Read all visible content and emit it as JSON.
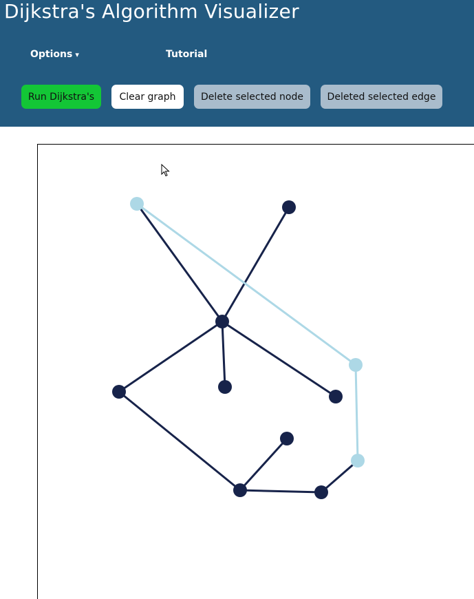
{
  "app": {
    "title": "Dijkstra's Algorithm Visualizer"
  },
  "nav": {
    "options_label": "Options",
    "options_caret": "▾",
    "tutorial_label": "Tutorial"
  },
  "toolbar": {
    "run_label": "Run Dijkstra's",
    "clear_label": "Clear graph",
    "delete_node_label": "Delete selected node",
    "delete_edge_label": "Deleted selected edge"
  },
  "colors": {
    "header_bg": "#235a80",
    "run_button": "#13c636",
    "disabled_button": "#a9bccc",
    "node_default": "#17234a",
    "node_path": "#add8e6",
    "edge_default": "#17234a",
    "edge_path": "#add8e6"
  },
  "graph": {
    "nodes": [
      {
        "id": "n1",
        "state": "path"
      },
      {
        "id": "n2",
        "state": "default"
      },
      {
        "id": "n3",
        "state": "default"
      },
      {
        "id": "n4",
        "state": "path"
      },
      {
        "id": "n5",
        "state": "default"
      },
      {
        "id": "n6",
        "state": "default"
      },
      {
        "id": "n7",
        "state": "default"
      },
      {
        "id": "n8",
        "state": "default"
      },
      {
        "id": "n9",
        "state": "path"
      },
      {
        "id": "n10",
        "state": "default"
      },
      {
        "id": "n11",
        "state": "default"
      }
    ],
    "edges": [
      {
        "from": "n1",
        "to": "n3",
        "state": "default"
      },
      {
        "from": "n2",
        "to": "n3",
        "state": "default"
      },
      {
        "from": "n3",
        "to": "n6",
        "state": "default"
      },
      {
        "from": "n3",
        "to": "n7",
        "state": "default"
      },
      {
        "from": "n3",
        "to": "n5",
        "state": "default"
      },
      {
        "from": "n5",
        "to": "n10",
        "state": "default"
      },
      {
        "from": "n10",
        "to": "n8",
        "state": "default"
      },
      {
        "from": "n10",
        "to": "n11",
        "state": "default"
      },
      {
        "from": "n11",
        "to": "n9",
        "state": "default"
      },
      {
        "from": "n1",
        "to": "n4",
        "state": "path"
      },
      {
        "from": "n4",
        "to": "n9",
        "state": "path"
      }
    ]
  }
}
